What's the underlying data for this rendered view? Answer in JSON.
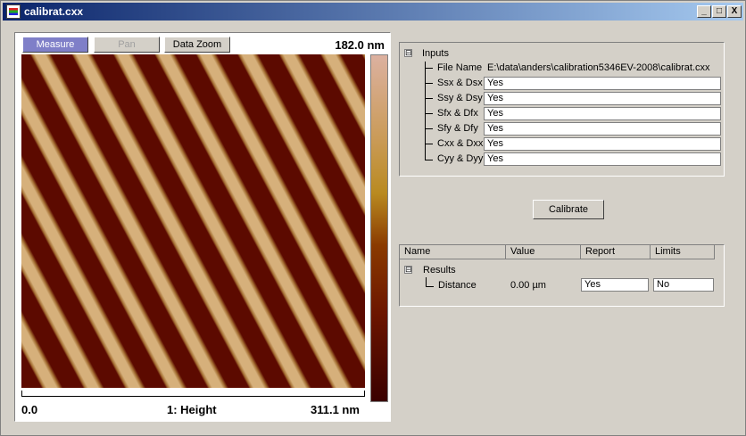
{
  "window": {
    "title": "calibrat.cxx",
    "minimize": "_",
    "maximize": "□",
    "close": "X"
  },
  "viewer": {
    "toolbar": {
      "measure": "Measure",
      "pan": "Pan",
      "data_zoom": "Data Zoom"
    },
    "z_scale": "182.0 nm",
    "x_min": "0.0",
    "channel": "1: Height",
    "x_max": "311.1 nm"
  },
  "inputs": {
    "header": "Inputs",
    "expander": "⊟",
    "file_name_label": "File Name",
    "file_name_value": "E:\\data\\anders\\calibration5346EV-2008\\calibrat.cxx",
    "rows": [
      {
        "label": "Ssx & Dsx",
        "value": "Yes"
      },
      {
        "label": "Ssy & Dsy",
        "value": "Yes"
      },
      {
        "label": "Sfx & Dfx",
        "value": "Yes"
      },
      {
        "label": "Sfy & Dfy",
        "value": "Yes"
      },
      {
        "label": "Cxx & Dxx",
        "value": "Yes"
      },
      {
        "label": "Cyy & Dyy",
        "value": "Yes"
      }
    ]
  },
  "calibrate_button": "Calibrate",
  "results": {
    "columns": [
      "Name",
      "Value",
      "Report",
      "Limits"
    ],
    "header": "Results",
    "expander": "⊟",
    "row": {
      "label": "Distance",
      "value": "0.00 µm",
      "report": "Yes",
      "limits": "No"
    }
  }
}
